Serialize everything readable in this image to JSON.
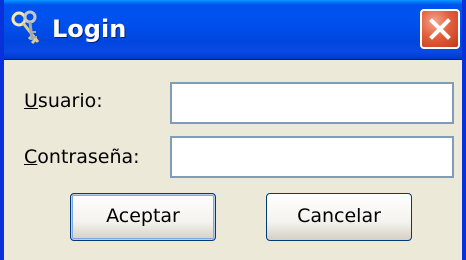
{
  "window": {
    "title": "Login",
    "icon": "keys-icon",
    "close_icon": "close-icon"
  },
  "form": {
    "username_label_accel": "U",
    "username_label_rest": "suario:",
    "username_value": "",
    "password_label_accel": "C",
    "password_label_rest": "ontraseña:",
    "password_value": ""
  },
  "buttons": {
    "accept_label": "Aceptar",
    "cancel_label": "Cancelar"
  },
  "colors": {
    "title_bar": "#0050ee",
    "close_button": "#e3603c",
    "dialog_background": "#ece9d8"
  }
}
